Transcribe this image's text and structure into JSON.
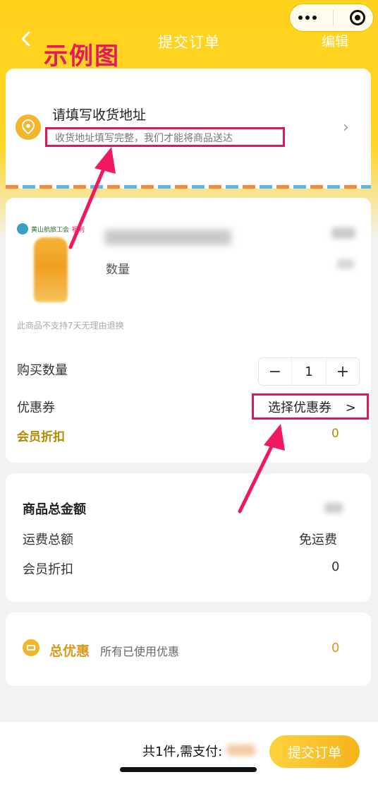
{
  "nav": {
    "title": "提交订单",
    "edit_label": "编辑",
    "sample_label": "示例图"
  },
  "address": {
    "title": "请填写收货地址",
    "hint": "收货地址填写完整，我们才能将商品送达",
    "chevron": "›"
  },
  "product": {
    "shop_name": "黄山航旅工会",
    "shop_tag": "福利",
    "quantity_label": "数量",
    "no_return_note": "此商品不支持7天无理由退换"
  },
  "order": {
    "purchase_qty_label": "购买数量",
    "qty_minus": "−",
    "qty_value": "1",
    "qty_plus": "+",
    "coupon_label": "优惠券",
    "coupon_select": "选择优惠券",
    "coupon_chevron": ">",
    "member_discount_label": "会员折扣",
    "member_discount_value": "0"
  },
  "totals": {
    "title": "商品总金额",
    "shipping_label": "运费总额",
    "shipping_value": "免运费",
    "member_discount_label": "会员折扣",
    "member_discount_value": "0"
  },
  "discount": {
    "title": "总优惠",
    "subtitle": "所有已使用优惠",
    "value": "0"
  },
  "footer": {
    "summary": "共1件,需支付:",
    "submit_label": "提交订单"
  },
  "colors": {
    "brand_yellow": "#ffd21c",
    "highlight_pink": "#d9195f",
    "gold_text": "#b38a00"
  }
}
